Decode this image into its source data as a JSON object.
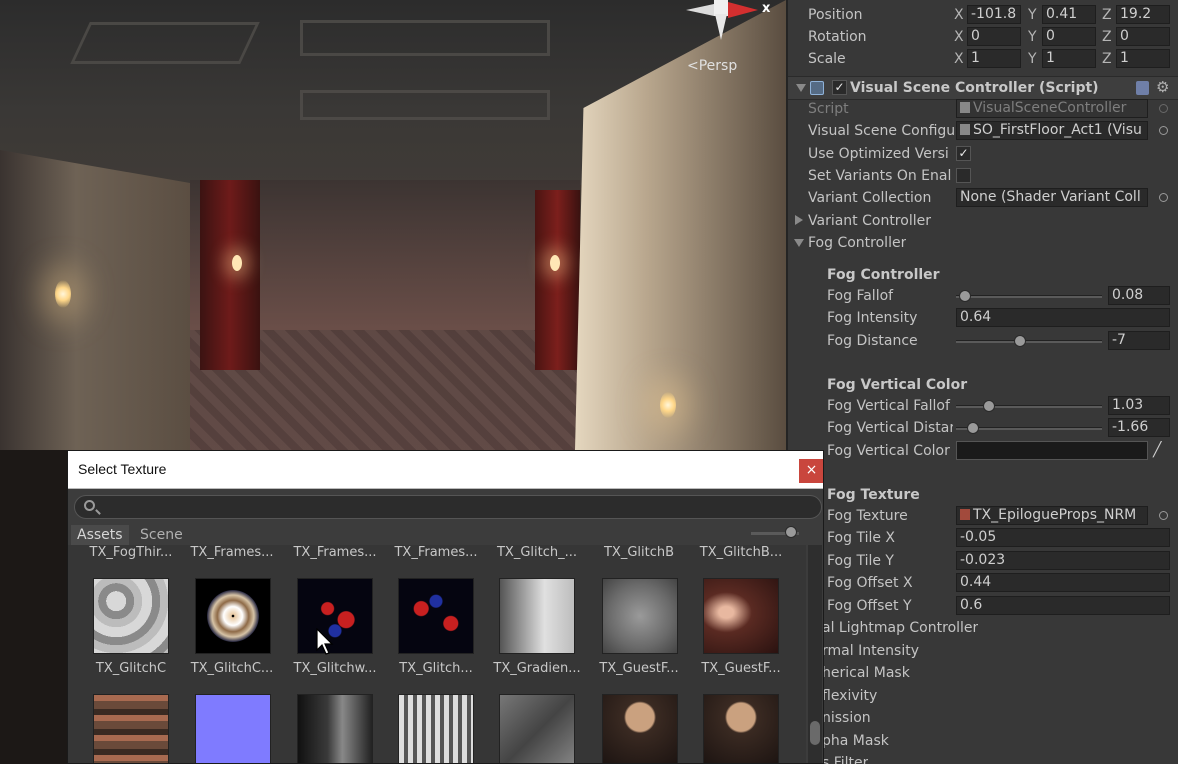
{
  "scene": {
    "persp_label": "Persp",
    "gizmo_axis": "x"
  },
  "inspector": {
    "transform": {
      "position": {
        "label": "Position",
        "x": "-101.8",
        "y": "0.41",
        "z": "19.2"
      },
      "rotation": {
        "label": "Rotation",
        "x": "0",
        "y": "0",
        "z": "0"
      },
      "scale": {
        "label": "Scale",
        "x": "1",
        "y": "1",
        "z": "1"
      },
      "axis_x": "X",
      "axis_y": "Y",
      "axis_z": "Z"
    },
    "component_title": "Visual Scene Controller (Script)",
    "script": {
      "label": "Script",
      "value": "VisualSceneController"
    },
    "visual_scene_config": {
      "label": "Visual Scene Configu",
      "value": "SO_FirstFloor_Act1 (Visu"
    },
    "use_optimized": {
      "label": "Use Optimized Versi",
      "checked": "✓"
    },
    "set_variants": {
      "label": "Set Variants On Enal"
    },
    "variant_collection": {
      "label": "Variant Collection",
      "value": "None (Shader Variant Coll"
    },
    "variant_controller": "Variant Controller",
    "fog_controller_foldout": "Fog Controller",
    "fog_controller_header": "Fog Controller",
    "fog_falloff": {
      "label": "Fog Fallof",
      "value": "0.08",
      "fraction": 0.02
    },
    "fog_intensity": {
      "label": "Fog Intensity",
      "value": "0.64"
    },
    "fog_distance": {
      "label": "Fog Distance",
      "value": "-7",
      "fraction": 0.43
    },
    "fog_vertical_color_header": "Fog Vertical Color",
    "fog_vertical_falloff": {
      "label": "Fog Vertical Fallof",
      "value": "1.03",
      "fraction": 0.2
    },
    "fog_vertical_distance": {
      "label": "Fog Vertical Distar",
      "value": "-1.66",
      "fraction": 0.08
    },
    "fog_vertical_color": {
      "label": "Fog Vertical Color",
      "color": "#1a1a1a"
    },
    "fog_texture_header": "Fog Texture",
    "fog_texture": {
      "label": "Fog Texture",
      "value": "TX_EpilogueProps_NRM"
    },
    "fog_tile_x": {
      "label": "Fog Tile X",
      "value": "-0.05"
    },
    "fog_tile_y": {
      "label": "Fog Tile Y",
      "value": "-0.023"
    },
    "fog_offset_x": {
      "label": "Fog Offset X",
      "value": "0.44"
    },
    "fog_offset_y": {
      "label": "Fog Offset Y",
      "value": "0.6"
    },
    "lower_items": [
      "al Lightmap Controller",
      "rmal Intensity",
      "herical Mask",
      "flexivity",
      "nission",
      "pha Mask",
      "s Filter"
    ]
  },
  "dialog": {
    "title": "Select Texture",
    "close_label": "×",
    "search_placeholder": "",
    "tabs": [
      "Assets",
      "Scene"
    ],
    "top_row_names": [
      "TX_FogThir...",
      "TX_Frames...",
      "TX_Frames...",
      "TX_Frames...",
      "TX_Glitch_...",
      "TX_GlitchB",
      "TX_GlitchB..."
    ],
    "row1_names": [
      "TX_GlitchC",
      "TX_GlitchC...",
      "TX_Glitchw...",
      "TX_Glitch...",
      "TX_Gradien...",
      "TX_GuestF...",
      "TX_GuestF..."
    ]
  },
  "colors": {
    "inspector_bg": "#383838",
    "field_bg": "#2a2a2a",
    "close_red": "#c9463d",
    "accent_red": "#d32f2f"
  }
}
